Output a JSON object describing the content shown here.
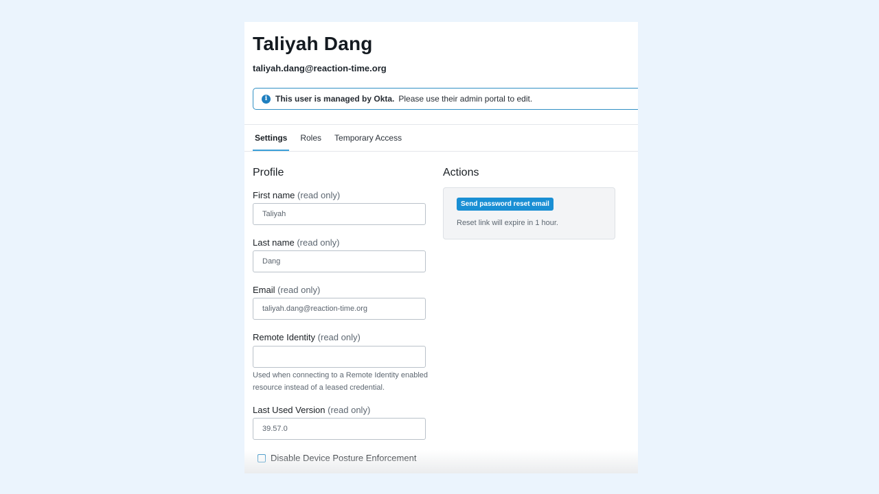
{
  "user": {
    "name": "Taliyah Dang",
    "email": "taliyah.dang@reaction-time.org"
  },
  "alert": {
    "icon": "info-icon",
    "strong_text": "This user is managed by Okta.",
    "text": "Please use their admin portal to edit.",
    "color": "#2f8fc4"
  },
  "tabs": [
    {
      "label": "Settings",
      "active": true
    },
    {
      "label": "Roles",
      "active": false
    },
    {
      "label": "Temporary Access",
      "active": false
    }
  ],
  "profile": {
    "title": "Profile",
    "read_only_suffix": "(read only)",
    "first_name": {
      "label": "First name",
      "value": "Taliyah"
    },
    "last_name": {
      "label": "Last name",
      "value": "Dang"
    },
    "email": {
      "label": "Email",
      "value": "taliyah.dang@reaction-time.org"
    },
    "remote_identity": {
      "label": "Remote Identity",
      "value": "",
      "help": "Used when connecting to a Remote Identity enabled resource instead of a leased credential."
    },
    "last_used_version": {
      "label": "Last Used Version",
      "value": "39.57.0"
    },
    "disable_posture": {
      "label": "Disable Device Posture Enforcement",
      "checked": false
    }
  },
  "actions": {
    "title": "Actions",
    "reset_button": "Send password reset email",
    "reset_note": "Reset link will expire in 1 hour.",
    "button_color": "#1a8fd4"
  }
}
